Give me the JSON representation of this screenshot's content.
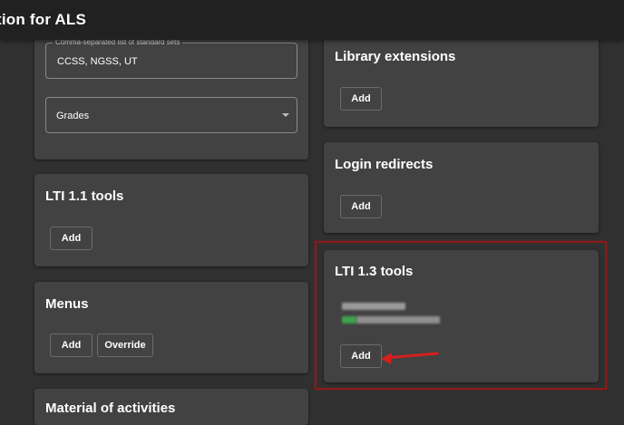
{
  "app_bar": {
    "title": "tion for ALS"
  },
  "standards_card": {
    "standard_sets": {
      "legend": "Comma-separated list of standard sets",
      "value": "CCSS, NGSS, UT"
    },
    "grades": {
      "value": "Grades"
    }
  },
  "lti11_card": {
    "title": "LTI 1.1 tools",
    "add_label": "Add"
  },
  "menus_card": {
    "title": "Menus",
    "add_label": "Add",
    "override_label": "Override"
  },
  "next_card": {
    "title": "Material of activities"
  },
  "library_card": {
    "title": "Library extensions",
    "add_label": "Add"
  },
  "login_card": {
    "title": "Login redirects",
    "add_label": "Add"
  },
  "lti13_card": {
    "title": "LTI 1.3 tools",
    "add_label": "Add"
  },
  "colors": {
    "app_bar": "#212121",
    "background": "#303030",
    "card": "#424242",
    "highlight": "#8b1a1a",
    "arrow": "#d71f1f"
  }
}
